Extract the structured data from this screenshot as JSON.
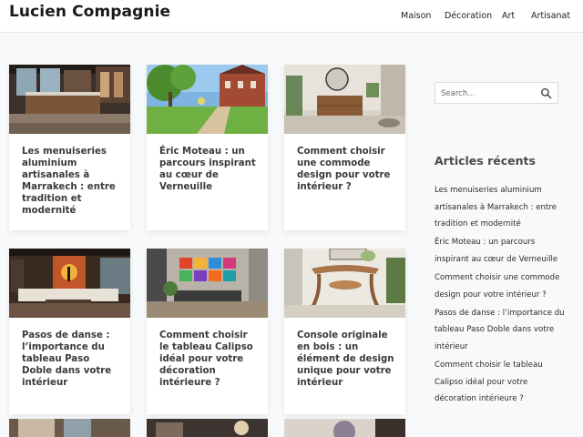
{
  "site": {
    "title": "Lucien Compagnie"
  },
  "nav": [
    {
      "label": "Maison"
    },
    {
      "label": "Décoration"
    },
    {
      "label": "Art"
    },
    {
      "label": "Artisanat"
    }
  ],
  "articles": [
    {
      "title": "Les menuiseries aluminium artisanales à Marrakech : entre tradition et modernité",
      "image": "kitchen-photo"
    },
    {
      "title": "Éric Moteau : un parcours inspirant au cœur de Verneuille",
      "image": "village-street-photo"
    },
    {
      "title": "Comment choisir une commode design pour votre intérieur ?",
      "image": "commode-photo"
    },
    {
      "title": "Pasos de danse : l’importance du tableau Paso Doble dans votre intérieur",
      "image": "living-room-photo"
    },
    {
      "title": "Comment choisir le tableau Calipso idéal pour votre décoration intérieure ?",
      "image": "painting-wall-photo"
    },
    {
      "title": "Console originale en bois : un élément de design unique pour votre intérieur",
      "image": "console-photo"
    }
  ],
  "search": {
    "placeholder": "Search..."
  },
  "sidebar": {
    "recent_heading": "Articles récents",
    "recent": [
      "Les menuiseries aluminium artisanales à Marrakech : entre tradition et modernité",
      "Éric Moteau : un parcours inspirant au cœur de Verneuille",
      "Comment choisir une commode design pour votre intérieur ?",
      "Pasos de danse : l’importance du tableau Paso Doble dans votre intérieur",
      "Comment choisir le tableau Calipso idéal pour votre décoration intérieure ?"
    ]
  },
  "colors": {
    "accent": "#1a1a1a",
    "text": "#3b3b3b",
    "background": "#f8f9fa"
  }
}
